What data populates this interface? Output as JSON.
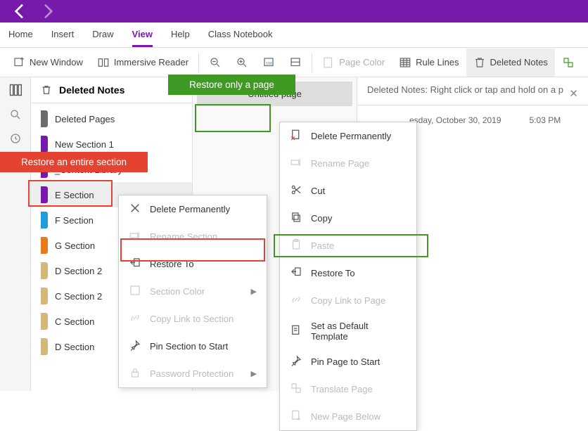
{
  "ribbon": {
    "tabs": [
      "Home",
      "Insert",
      "Draw",
      "View",
      "Help",
      "Class Notebook"
    ],
    "active": "View"
  },
  "toolbar": {
    "new_window": "New Window",
    "immersive_reader": "Immersive Reader",
    "page_color": "Page Color",
    "rule_lines": "Rule Lines",
    "deleted_notes": "Deleted Notes"
  },
  "panel": {
    "title": "Deleted Notes",
    "sections": [
      {
        "label": "Deleted Pages",
        "color": "#6b6b6b"
      },
      {
        "label": "New Section 1",
        "color": "#7719AA"
      },
      {
        "label": "_Content Library",
        "color": "#7719AA"
      },
      {
        "label": "E Section",
        "color": "#7719AA",
        "selected": true
      },
      {
        "label": "F Section",
        "color": "#1f9bde"
      },
      {
        "label": "G Section",
        "color": "#e87a1a"
      },
      {
        "label": "D Section 2",
        "color": "#d6b77a"
      },
      {
        "label": "C Section 2",
        "color": "#d6b77a"
      },
      {
        "label": "C Section",
        "color": "#d6b77a"
      },
      {
        "label": "D Section",
        "color": "#d6b77a"
      }
    ]
  },
  "pages": {
    "items": [
      {
        "title": "Untitled page"
      }
    ]
  },
  "note": {
    "header": "Deleted Notes: Right click or tap and hold on a p",
    "date": "esday, October 30, 2019",
    "time": "5:03 PM"
  },
  "ctx_section": {
    "items": [
      {
        "label": "Delete Permanently",
        "icon": "x",
        "disabled": false
      },
      {
        "label": "Rename Section",
        "icon": "rename",
        "disabled": true
      },
      {
        "label": "Restore To",
        "icon": "restore",
        "disabled": false
      },
      {
        "label": "Section Color",
        "icon": "color",
        "disabled": true,
        "submenu": true
      },
      {
        "label": "Copy Link to Section",
        "icon": "link",
        "disabled": true
      },
      {
        "label": "Pin Section to Start",
        "icon": "pin",
        "disabled": false
      },
      {
        "label": "Password Protection",
        "icon": "lock",
        "disabled": true,
        "submenu": true
      }
    ]
  },
  "ctx_page": {
    "items": [
      {
        "label": "Delete Permanently",
        "icon": "x-page",
        "disabled": false
      },
      {
        "label": "Rename Page",
        "icon": "rename",
        "disabled": true
      },
      {
        "label": "Cut",
        "icon": "cut",
        "disabled": false
      },
      {
        "label": "Copy",
        "icon": "copy",
        "disabled": false
      },
      {
        "label": "Paste",
        "icon": "paste",
        "disabled": true
      },
      {
        "label": "Restore To",
        "icon": "restore",
        "disabled": false
      },
      {
        "label": "Copy Link to Page",
        "icon": "link",
        "disabled": true
      },
      {
        "label": "Set as Default Template",
        "icon": "template",
        "disabled": false
      },
      {
        "label": "Pin Page to Start",
        "icon": "pin",
        "disabled": false
      },
      {
        "label": "Translate Page",
        "icon": "translate",
        "disabled": true
      },
      {
        "label": "New Page Below",
        "icon": "newpage",
        "disabled": true
      }
    ]
  },
  "callouts": {
    "page": "Restore only a page",
    "section": "Restore an entire section"
  }
}
